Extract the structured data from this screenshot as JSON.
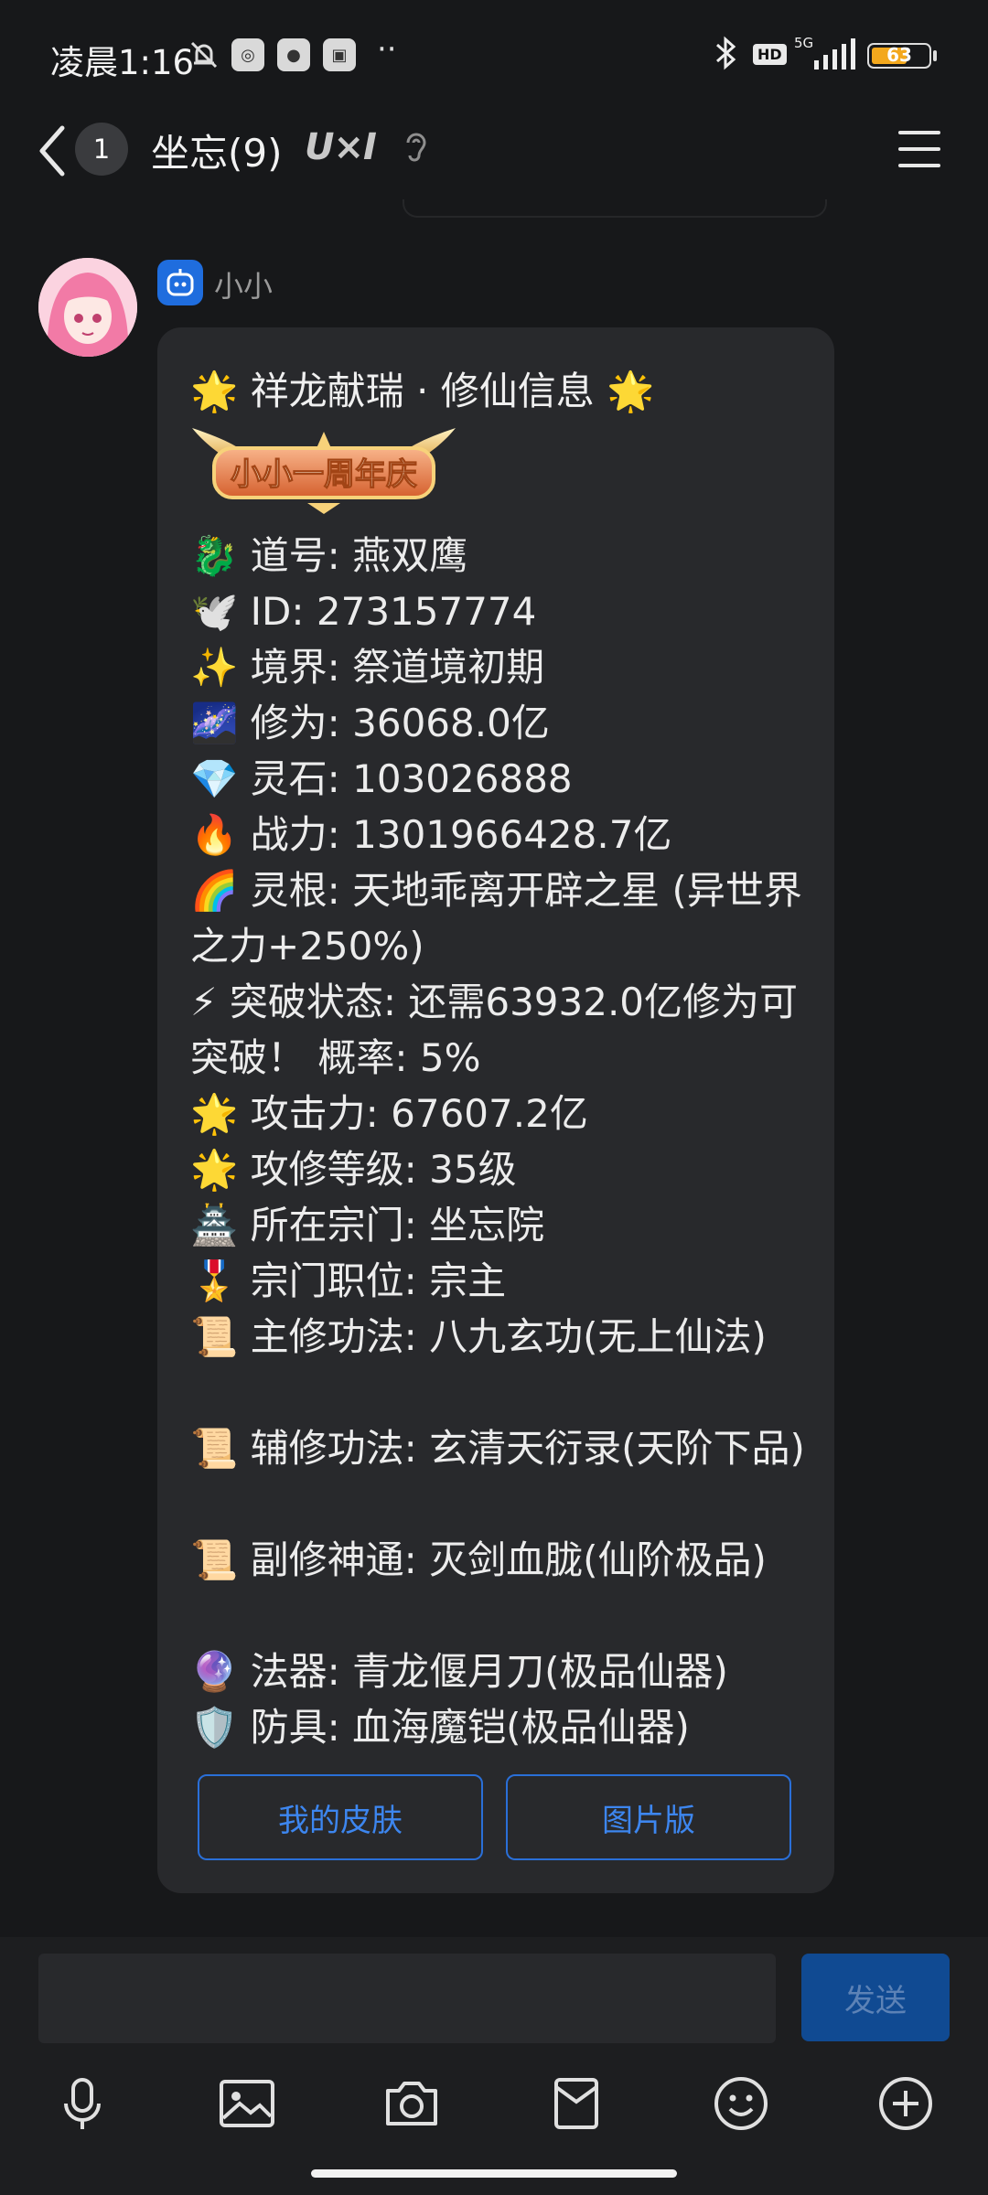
{
  "status_bar": {
    "time": "凌晨1:16",
    "dots": "··",
    "hd": "HD",
    "network": "5G",
    "battery_level": "63",
    "battery_fraction": 0.63
  },
  "header": {
    "unread_count": "1",
    "title": "坐忘(9)",
    "badge": "U×I"
  },
  "message": {
    "sender": "小小",
    "title": "🌟 祥龙献瑞 · 修仙信息 🌟",
    "banner_text": "小小一周年庆",
    "lines": [
      "🐉 道号: 燕双鹰",
      "🕊️ ID: 273157774",
      "✨ 境界: 祭道境初期",
      "🌌 修为: 36068.0亿",
      "💎 灵石: 103026888",
      "🔥 战力: 1301966428.7亿",
      "🌈 灵根: 天地乖离开辟之星 (异世界之力+250%)",
      "⚡ 突破状态: 还需63932.0亿修为可突破！ 概率: 5%",
      "🌟 攻击力: 67607.2亿",
      "🌟 攻修等级: 35级",
      "🏯 所在宗门: 坐忘院",
      "🎖️ 宗门职位: 宗主",
      "📜 主修功法: 八九玄功(无上仙法)",
      "📜 辅修功法: 玄清天衍录(天阶下品)",
      "📜 副修神通: 灭剑血胧(仙阶极品)",
      "🔮 法器: 青龙偃月刀(极品仙器)",
      "🛡️ 防具: 血海魔铠(极品仙器)"
    ],
    "buttons": {
      "skin": "我的皮肤",
      "image_version": "图片版"
    }
  },
  "input": {
    "value": "",
    "send_label": "发送"
  },
  "toolbar": [
    "microphone-icon",
    "image-icon",
    "camera-icon",
    "red-packet-icon",
    "emoji-icon",
    "plus-icon"
  ],
  "colors": {
    "background": "#17181a",
    "bubble": "#28292c",
    "accent": "#2a6fd8",
    "battery": "#f3a81d"
  }
}
